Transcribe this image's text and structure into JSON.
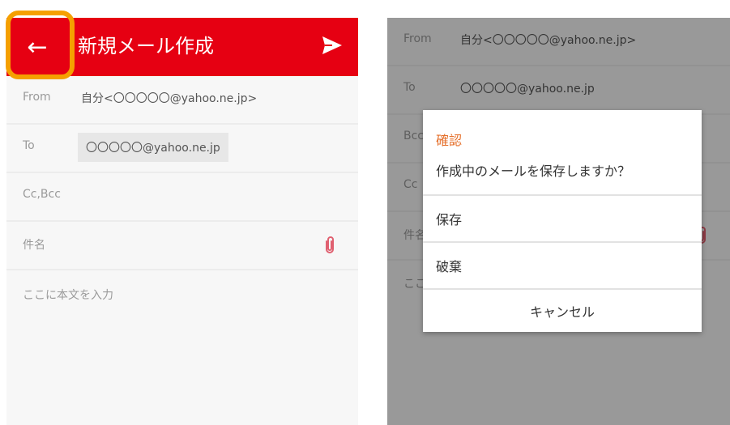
{
  "compose": {
    "title": "新規メール作成",
    "from_label": "From",
    "from_value": "自分<〇〇〇〇〇@yahoo.ne.jp>",
    "to_label": "To",
    "to_value": "〇〇〇〇〇@yahoo.ne.jp",
    "cc_label": "Cc,Bcc",
    "subject_label": "件名",
    "body_placeholder": "ここに本文を入力"
  },
  "background": {
    "from_label": "From",
    "from_value": "自分<〇〇〇〇〇@yahoo.ne.jp>",
    "to_label": "To",
    "to_value": "〇〇〇〇〇@yahoo.ne.jp",
    "bcc_label": "Bcc",
    "cc_label": "Cc",
    "subject_label": "件名",
    "body_placeholder": "ここ"
  },
  "dialog": {
    "title": "確認",
    "message": "作成中のメールを保存しますか？",
    "option_save": "保存",
    "option_discard": "破棄",
    "cancel": "キャンセル"
  },
  "colors": {
    "accent": "#e60012",
    "highlight": "#f5a000",
    "dialog_title": "#e56f2a"
  },
  "icons": {
    "back": "arrow-left-icon",
    "send": "send-icon",
    "attach": "paperclip-icon"
  }
}
